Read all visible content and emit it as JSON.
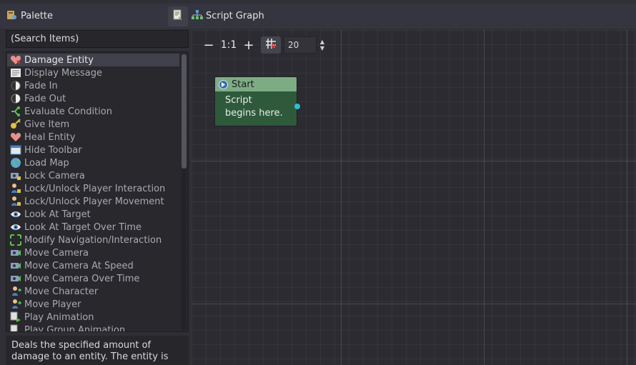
{
  "palette": {
    "title": "Palette",
    "search_value": "(Search Items)",
    "items": [
      {
        "label": "Damage Entity",
        "icon": "heart-damage-icon",
        "selected": true
      },
      {
        "label": "Display Message",
        "icon": "message-icon"
      },
      {
        "label": "Fade In",
        "icon": "fade-in-icon"
      },
      {
        "label": "Fade Out",
        "icon": "fade-out-icon"
      },
      {
        "label": "Evaluate Condition",
        "icon": "condition-icon"
      },
      {
        "label": "Give Item",
        "icon": "key-icon"
      },
      {
        "label": "Heal Entity",
        "icon": "heart-icon"
      },
      {
        "label": "Hide Toolbar",
        "icon": "toolbar-icon"
      },
      {
        "label": "Load Map",
        "icon": "globe-icon"
      },
      {
        "label": "Lock Camera",
        "icon": "camera-lock-icon"
      },
      {
        "label": "Lock/Unlock Player Interaction",
        "icon": "player-lock-icon"
      },
      {
        "label": "Lock/Unlock Player Movement",
        "icon": "player-lock-icon"
      },
      {
        "label": "Look At Target",
        "icon": "eye-icon"
      },
      {
        "label": "Look At Target Over Time",
        "icon": "eye-icon"
      },
      {
        "label": "Modify Navigation/Interaction",
        "icon": "expand-arrows-icon"
      },
      {
        "label": "Move Camera",
        "icon": "camera-icon"
      },
      {
        "label": "Move Camera At Speed",
        "icon": "camera-icon"
      },
      {
        "label": "Move Camera Over Time",
        "icon": "camera-icon"
      },
      {
        "label": "Move Character",
        "icon": "character-icon"
      },
      {
        "label": "Move Player",
        "icon": "character-icon"
      },
      {
        "label": "Play Animation",
        "icon": "animation-icon"
      },
      {
        "label": "Play Group Animation",
        "icon": "animation-icon"
      }
    ],
    "description": "Deals the specified amount of damage to an entity. The entity is"
  },
  "header": {
    "tab_label": "Script Graph"
  },
  "graph": {
    "zoom_out": "−",
    "zoom_reset": "1:1",
    "zoom_in": "+",
    "grid_size": "20",
    "node": {
      "title": "Start",
      "body_line1": "Script",
      "body_line2": "begins here."
    }
  },
  "colors": {
    "node_header": "#7dac84",
    "node_body": "#2e5a3b",
    "port": "#2bc0d0"
  }
}
